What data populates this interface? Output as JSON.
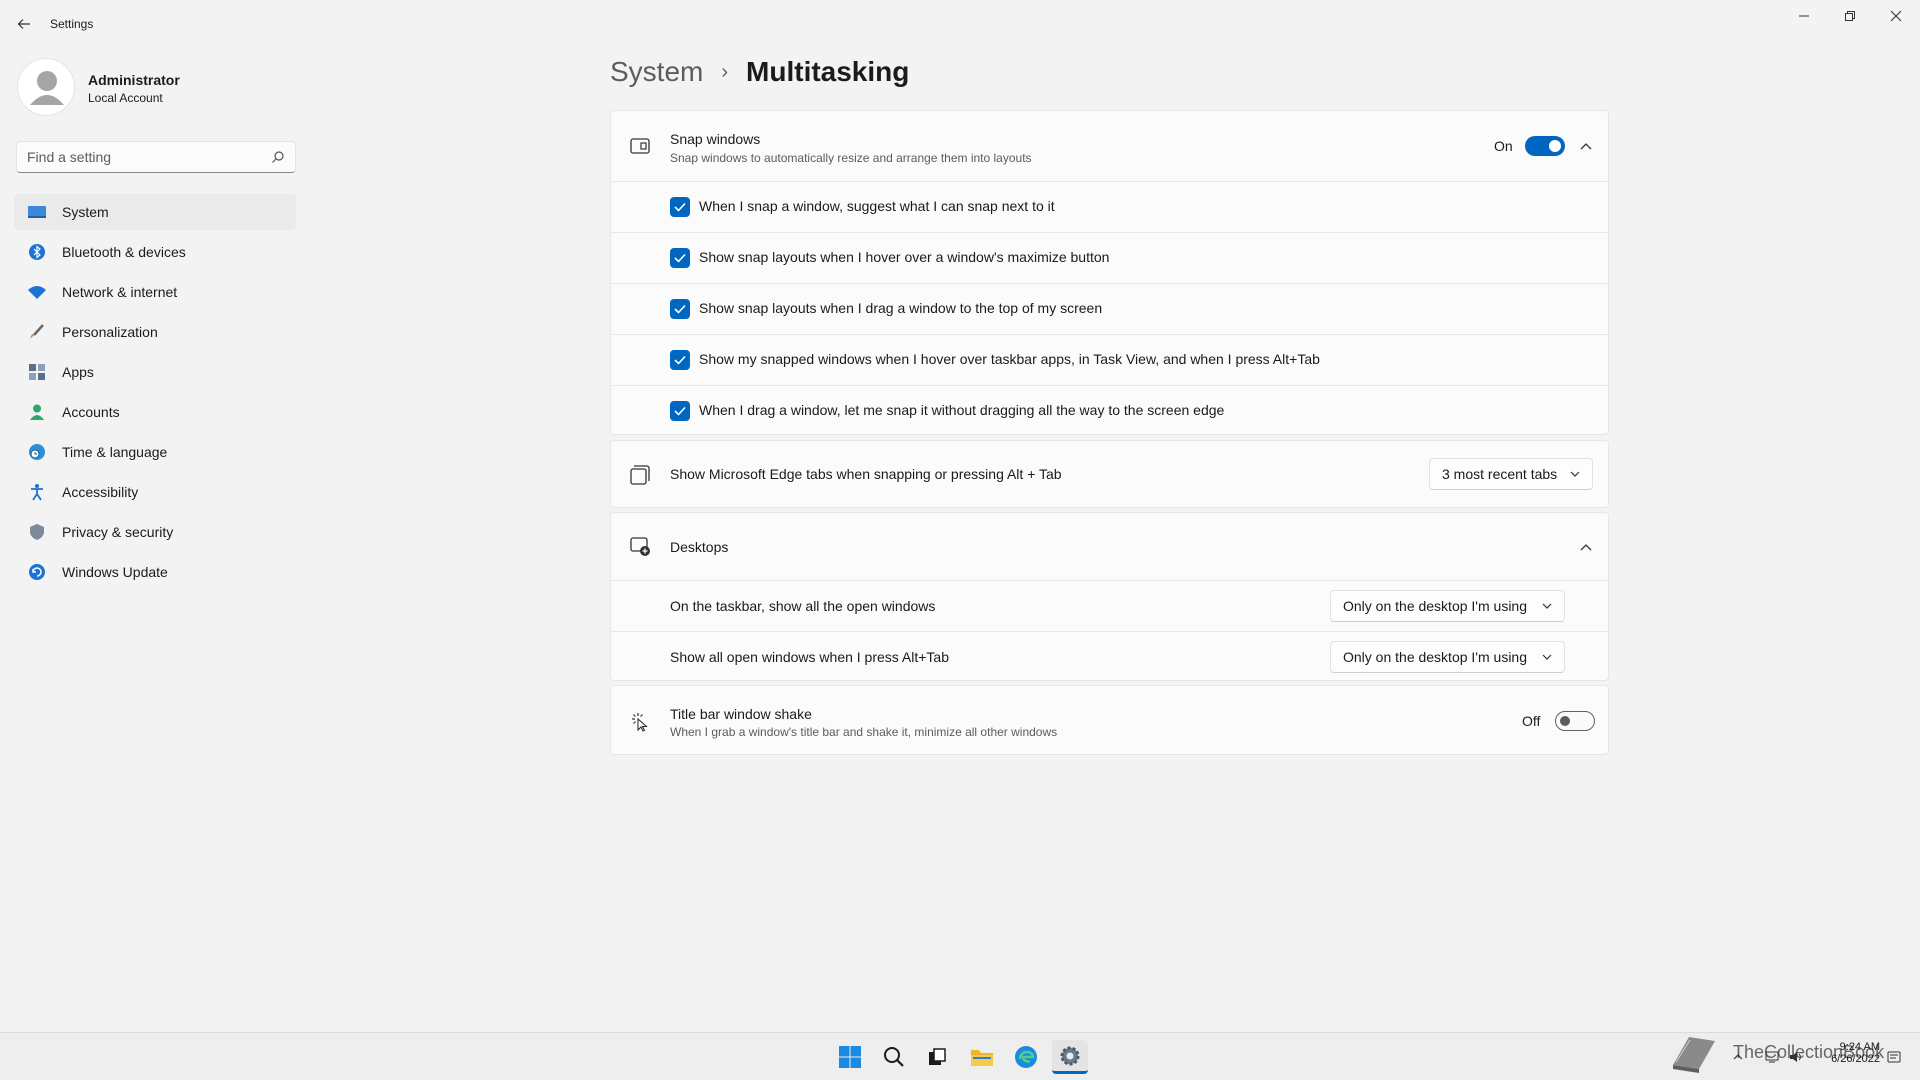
{
  "app": {
    "title": "Settings"
  },
  "user": {
    "name": "Administrator",
    "account_type": "Local Account"
  },
  "search": {
    "placeholder": "Find a setting"
  },
  "sidebar": {
    "items": [
      {
        "label": "System",
        "icon": "monitor-icon",
        "active": true
      },
      {
        "label": "Bluetooth & devices",
        "icon": "bluetooth-icon"
      },
      {
        "label": "Network & internet",
        "icon": "wifi-icon"
      },
      {
        "label": "Personalization",
        "icon": "brush-icon"
      },
      {
        "label": "Apps",
        "icon": "apps-icon"
      },
      {
        "label": "Accounts",
        "icon": "person-icon"
      },
      {
        "label": "Time & language",
        "icon": "globe-clock-icon"
      },
      {
        "label": "Accessibility",
        "icon": "accessibility-icon"
      },
      {
        "label": "Privacy & security",
        "icon": "shield-icon"
      },
      {
        "label": "Windows Update",
        "icon": "update-icon"
      }
    ]
  },
  "breadcrumb": {
    "parent": "System",
    "separator": "›",
    "current": "Multitasking"
  },
  "snap": {
    "title": "Snap windows",
    "subtitle": "Snap windows to automatically resize and arrange them into layouts",
    "state_label": "On",
    "enabled": true,
    "options": [
      {
        "label": "When I snap a window, suggest what I can snap next to it",
        "checked": true
      },
      {
        "label": "Show snap layouts when I hover over a window's maximize button",
        "checked": true
      },
      {
        "label": "Show snap layouts when I drag a window to the top of my screen",
        "checked": true
      },
      {
        "label": "Show my snapped windows when I hover over taskbar apps, in Task View, and when I press Alt+Tab",
        "checked": true
      },
      {
        "label": "When I drag a window, let me snap it without dragging all the way to the screen edge",
        "checked": true
      }
    ]
  },
  "edge": {
    "title": "Show Microsoft Edge tabs when snapping or pressing Alt + Tab",
    "value": "3 most recent tabs"
  },
  "desktops": {
    "title": "Desktops",
    "rows": [
      {
        "label": "On the taskbar, show all the open windows",
        "value": "Only on the desktop I'm using"
      },
      {
        "label": "Show all open windows when I press Alt+Tab",
        "value": "Only on the desktop I'm using"
      }
    ]
  },
  "shake": {
    "title": "Title bar window shake",
    "subtitle": "When I grab a window's title bar and shake it, minimize all other windows",
    "state_label": "Off",
    "enabled": false
  },
  "tray": {
    "time": "9:24 AM",
    "date": "6/26/2022",
    "watermark": "TheCollectionBook"
  },
  "colors": {
    "accent": "#0067c0",
    "background": "#f3f3f3",
    "card": "#fbfbfb"
  }
}
